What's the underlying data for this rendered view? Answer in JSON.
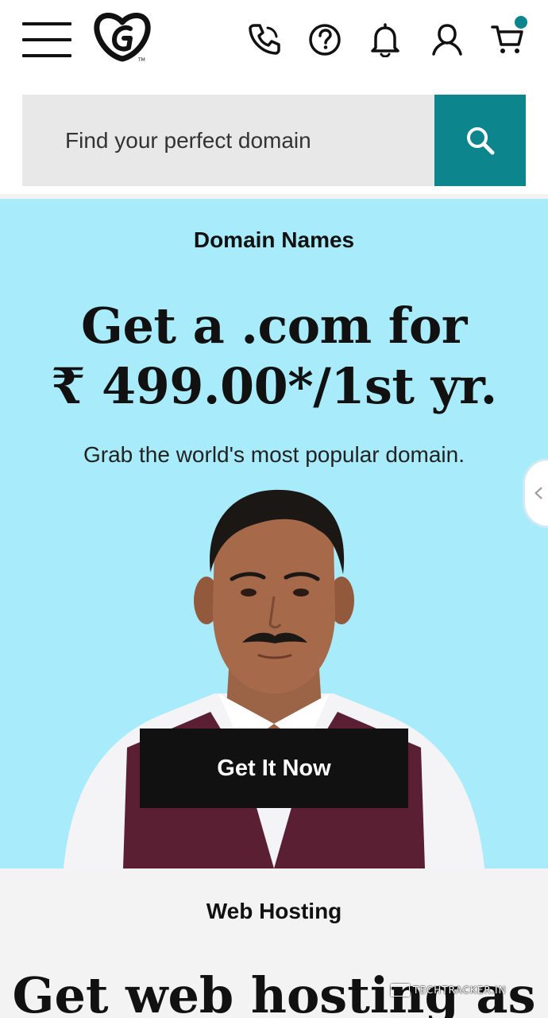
{
  "colors": {
    "accent_teal": "#0d858d",
    "hero_bg": "#a8ecfb",
    "section_bg": "#f3f3f3",
    "cta_bg": "#111111",
    "cart_badge": "#0d858d"
  },
  "header": {
    "icons": [
      "menu-icon",
      "godaddy-logo",
      "phone-icon",
      "help-icon",
      "bell-icon",
      "account-icon",
      "cart-icon"
    ]
  },
  "search": {
    "placeholder": "Find your perfect domain",
    "button_icon": "search-icon"
  },
  "hero": {
    "eyebrow": "Domain Names",
    "headline_line1": "Get a .com for",
    "headline_line2": "₹ 499.00*/1st yr.",
    "subtext": "Grab the world's most popular domain.",
    "cta_label": "Get It Now",
    "side_tab_icon": "chevron-left-icon"
  },
  "hosting": {
    "eyebrow": "Web Hosting",
    "headline": "Get web hosting as"
  },
  "watermark": {
    "text": "TECHTRACKER.IN"
  }
}
